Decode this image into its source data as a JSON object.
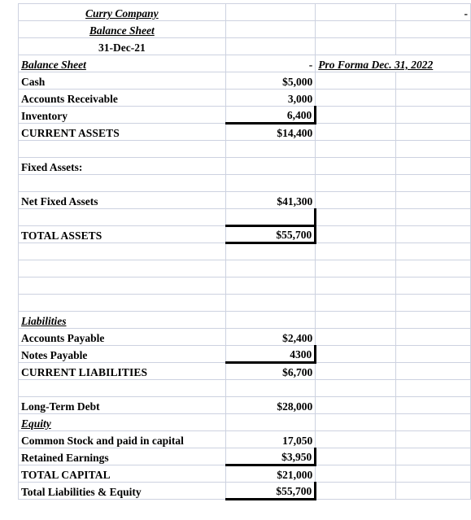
{
  "document": {
    "company": "Curry Company",
    "statement": "Balance Sheet",
    "as_of_date": "31-Dec-21",
    "section_header_label": "Balance Sheet",
    "pro_forma_header": "Pro Forma Dec. 31, 2022",
    "empty_marker": "-"
  },
  "columns": {
    "a": "",
    "b": "",
    "c": "",
    "d": ""
  },
  "rows": [
    {
      "label": "",
      "value": "",
      "pro_forma": "",
      "far": "-"
    },
    {
      "label": "",
      "value": "",
      "pro_forma": "",
      "far": ""
    },
    {
      "label": "",
      "value": "",
      "pro_forma": "",
      "far": ""
    },
    {
      "label": "Balance Sheet",
      "value": "-",
      "pro_forma": "Pro Forma Dec. 31, 2022",
      "far": ""
    },
    {
      "label": "Cash",
      "value": "$5,000",
      "pro_forma": "",
      "far": ""
    },
    {
      "label": "Accounts Receivable",
      "value": "3,000",
      "pro_forma": "",
      "far": ""
    },
    {
      "label": "Inventory",
      "value": "6,400",
      "pro_forma": "",
      "far": ""
    },
    {
      "label": "CURRENT ASSETS",
      "value": "$14,400",
      "pro_forma": "",
      "far": ""
    },
    {
      "label": "",
      "value": "",
      "pro_forma": "",
      "far": ""
    },
    {
      "label": "Fixed Assets:",
      "value": "",
      "pro_forma": "",
      "far": ""
    },
    {
      "label": "",
      "value": "",
      "pro_forma": "",
      "far": ""
    },
    {
      "label": "Net Fixed Assets",
      "value": "$41,300",
      "pro_forma": "",
      "far": ""
    },
    {
      "label": "",
      "value": "",
      "pro_forma": "",
      "far": ""
    },
    {
      "label": "TOTAL ASSETS",
      "value": "$55,700",
      "pro_forma": "",
      "far": ""
    },
    {
      "label": "",
      "value": "",
      "pro_forma": "",
      "far": ""
    },
    {
      "label": "",
      "value": "",
      "pro_forma": "",
      "far": ""
    },
    {
      "label": "",
      "value": "",
      "pro_forma": "",
      "far": ""
    },
    {
      "label": "",
      "value": "",
      "pro_forma": "",
      "far": ""
    },
    {
      "label": "Liabilities",
      "value": "",
      "pro_forma": "",
      "far": ""
    },
    {
      "label": "Accounts Payable",
      "value": "$2,400",
      "pro_forma": "",
      "far": ""
    },
    {
      "label": "Notes Payable",
      "value": "4300",
      "pro_forma": "",
      "far": ""
    },
    {
      "label": "CURRENT LIABILITIES",
      "value": "$6,700",
      "pro_forma": "",
      "far": ""
    },
    {
      "label": "",
      "value": "",
      "pro_forma": "",
      "far": ""
    },
    {
      "label": "Long-Term Debt",
      "value": "$28,000",
      "pro_forma": "",
      "far": ""
    },
    {
      "label": "Equity",
      "value": "",
      "pro_forma": "",
      "far": ""
    },
    {
      "label": "Common Stock and paid in capital",
      "value": "17,050",
      "pro_forma": "",
      "far": ""
    },
    {
      "label": "Retained Earnings",
      "value": "$3,950",
      "pro_forma": "",
      "far": ""
    },
    {
      "label": "TOTAL CAPITAL",
      "value": "$21,000",
      "pro_forma": "",
      "far": ""
    },
    {
      "label": "Total Liabilities & Equity",
      "value": "$55,700",
      "pro_forma": "",
      "far": ""
    }
  ],
  "line_items": {
    "assets": {
      "cash": {
        "label": "Cash",
        "value": "$5,000"
      },
      "accounts_receivable": {
        "label": "Accounts Receivable",
        "value": "3,000"
      },
      "inventory": {
        "label": "Inventory",
        "value": "6,400"
      },
      "current_assets": {
        "label": "CURRENT ASSETS",
        "value": "$14,400"
      },
      "fixed_assets_header": {
        "label": "Fixed Assets:",
        "value": ""
      },
      "net_fixed_assets": {
        "label": "Net Fixed Assets",
        "value": "$41,300"
      },
      "total_assets": {
        "label": "TOTAL ASSETS",
        "value": "$55,700"
      }
    },
    "liabilities": {
      "header": {
        "label": "Liabilities"
      },
      "accounts_payable": {
        "label": "Accounts Payable",
        "value": "$2,400"
      },
      "notes_payable": {
        "label": "Notes Payable",
        "value": "4300"
      },
      "current_liabilities": {
        "label": "CURRENT LIABILITIES",
        "value": "$6,700"
      },
      "long_term_debt": {
        "label": "Long-Term Debt",
        "value": "$28,000"
      }
    },
    "equity": {
      "header": {
        "label": "Equity"
      },
      "common_stock": {
        "label": "Common Stock and paid in capital",
        "value": "17,050"
      },
      "retained_earnings": {
        "label": "Retained Earnings",
        "value": "$3,950"
      },
      "total_capital": {
        "label": "TOTAL CAPITAL",
        "value": "$21,000"
      },
      "total_liabilities_equity": {
        "label": "Total Liabilities & Equity",
        "value": "$55,700"
      }
    }
  },
  "colors": {
    "grid_line": "#cdd2e0",
    "rule": "#000000",
    "text": "#000000",
    "background": "#ffffff"
  }
}
